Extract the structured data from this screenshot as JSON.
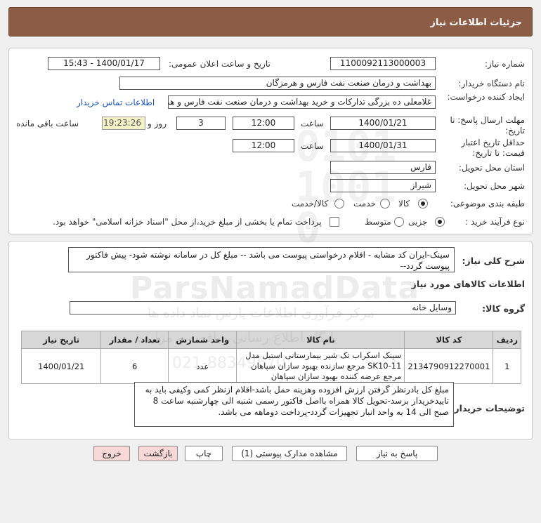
{
  "header": {
    "title": "جزئیات اطلاعات نیاز"
  },
  "fields": {
    "need_number_label": "شماره نیاز:",
    "need_number": "1100092113000003",
    "announce_label": "تاریخ و ساعت اعلان عمومی:",
    "announce_value": "1400/01/17 - 15:43",
    "buyer_org_label": "نام دستگاه خریدار:",
    "buyer_org": "بهداشت و درمان صنعت نفت فارس و هرمزگان",
    "creator_label": "ایجاد کننده درخواست:",
    "creator": "غلامعلی ده بزرگی تدارکات و خرید بهداشت و درمان صنعت نفت فارس و هرمزگان",
    "contact_link": "اطلاعات تماس خریدار",
    "reply_deadline_label": "مهلت ارسال پاسخ: تا تاریخ:",
    "reply_date": "1400/01/21",
    "time_label": "ساعت",
    "reply_time": "12:00",
    "days_value": "3",
    "days_label": "روز و",
    "remaining_time": "19:23:26",
    "remaining_label": "ساعت باقی مانده",
    "validity_label": "حداقل تاریخ اعتبار قیمت: تا تاریخ:",
    "validity_date": "1400/01/31",
    "validity_time": "12:00",
    "province_label": "استان محل تحویل:",
    "province": "فارس",
    "city_label": "شهر محل تحویل:",
    "city": "شیراز",
    "category_label": "طبقه بندی موضوعی:",
    "category_options": [
      "کالا",
      "خدمت",
      "کالا/خدمت"
    ],
    "process_label": "نوع فرآیند خرید :",
    "process_options": [
      "جزیی",
      "متوسط"
    ],
    "payment_note": "پرداخت تمام یا بخشی از مبلغ خرید،از محل \"اسناد خزانه اسلامی\" خواهد بود."
  },
  "summary": {
    "label": "شرح کلی نیاز:",
    "text": "سینک-ایران کد مشابه - اقلام درخواستی پیوست می باشد -- مبلغ کل در سامانه نوشته شود- پیش فاکتور پیوست گردد--"
  },
  "goods": {
    "section_title": "اطلاعات کالاهای مورد نیاز",
    "group_label": "گروه کالا:",
    "group_value": "وسایل خانه",
    "columns": [
      "ردیف",
      "کد کالا",
      "نام کالا",
      "واحد شمارش",
      "تعداد / مقدار",
      "تاریخ نیاز"
    ],
    "rows": [
      {
        "index": "1",
        "code": "2134790912270001",
        "name": "سینک اسکراب تک شیر بیمارستانی استیل مدل SK10-11 مرجع سازنده بهبود سازان سپاهان مرجع عرضه کننده بهبود سازان سپاهان",
        "unit": "عدد",
        "qty": "6",
        "date": "1400/01/21"
      }
    ]
  },
  "buyer_notes": {
    "label": "توضیحات خریدار:",
    "text": "مبلغ کل بادرنظر گرفتن ارزش افزوده وهزینه حمل باشد-اقلام ازنظر کمی وکیفی باید به تاییدخریدار برسد-تحویل کالا همراه بااصل فاکتور رسمی شنبه الی چهارشنبه ساعت 8 صبح الی 14 به واحد انبار تجهیزات گردد-پرداخت دوماهه می باشد."
  },
  "buttons": {
    "reply": "پاسخ به نیاز",
    "attachments": "مشاهده مدارک پیوستی (1)",
    "print": "چاپ",
    "back": "بازگشت",
    "exit": "خروج"
  },
  "watermark": {
    "brand": "ParsNamadData",
    "line1": "مرکز فرآوری اطلاعات پارس نماد داده ها",
    "line2": "پایگاه اطلاع رسانی مناقصه و مزایده",
    "phone": "021-88349670"
  }
}
